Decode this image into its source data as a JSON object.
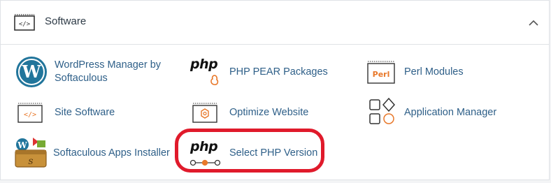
{
  "section": {
    "title": "Software",
    "icon": "code-icon",
    "collapse_icon": "chevron-up-icon"
  },
  "items": [
    {
      "label": "WordPress Manager by Softaculous",
      "icon": "wordpress-icon"
    },
    {
      "label": "PHP PEAR Packages",
      "icon": "php-pear-icon",
      "icon_text": "php"
    },
    {
      "label": "Perl Modules",
      "icon": "perl-icon",
      "icon_text": "Perl"
    },
    {
      "label": "Site Software",
      "icon": "code-icon"
    },
    {
      "label": "Optimize Website",
      "icon": "optimize-icon"
    },
    {
      "label": "Application Manager",
      "icon": "application-manager-icon"
    },
    {
      "label": "Softaculous Apps Installer",
      "icon": "softaculous-icon"
    },
    {
      "label": "Select PHP Version",
      "icon": "php-version-icon",
      "icon_text": "php"
    }
  ],
  "colors": {
    "link": "#2e5f88",
    "accent_orange": "#e8782a",
    "highlight": "#e01a2b",
    "wordpress_blue": "#21759b"
  }
}
